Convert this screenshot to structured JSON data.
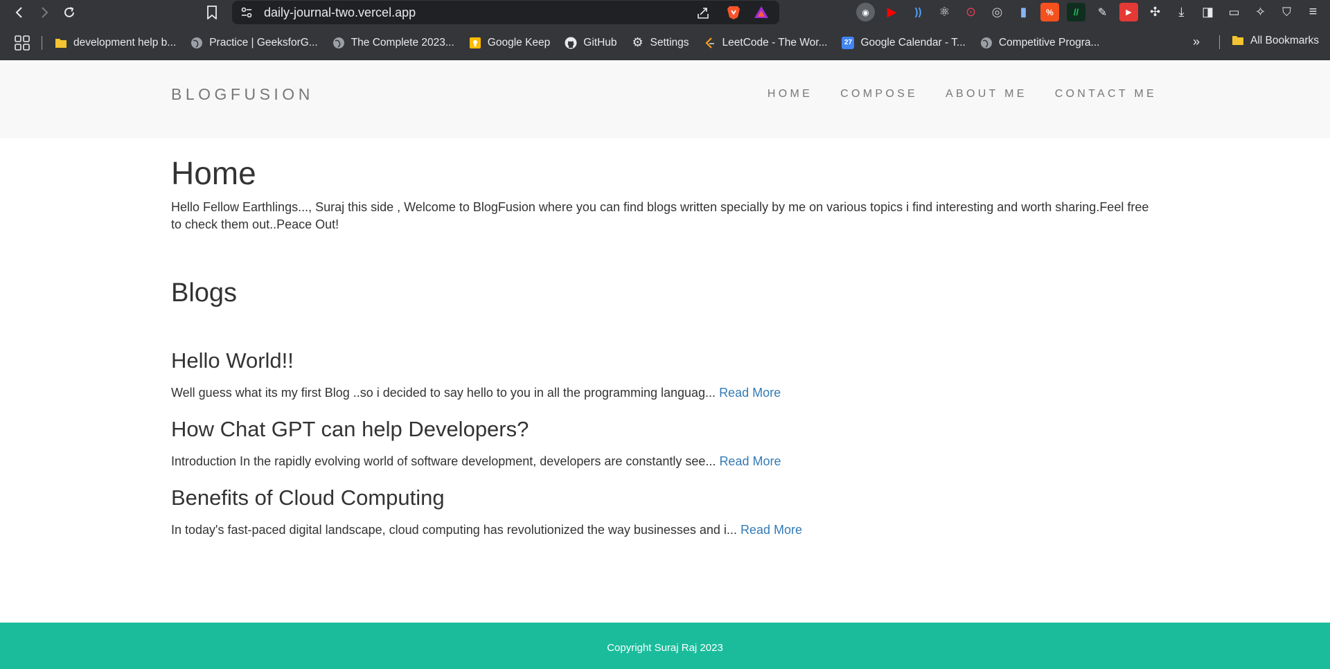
{
  "browser": {
    "url": "daily-journal-two.vercel.app",
    "bookmarks": [
      {
        "label": "development help b...",
        "icon": "folder-icon"
      },
      {
        "label": "Practice | GeeksforG...",
        "icon": "globe-icon"
      },
      {
        "label": "The Complete 2023...",
        "icon": "globe-icon"
      },
      {
        "label": "Google Keep",
        "icon": "keep-icon"
      },
      {
        "label": "GitHub",
        "icon": "github-icon"
      },
      {
        "label": "Settings",
        "icon": "gear-icon"
      },
      {
        "label": "LeetCode - The Wor...",
        "icon": "leetcode-icon"
      },
      {
        "label": "Google Calendar - T...",
        "icon": "calendar-icon"
      },
      {
        "label": "Competitive Progra...",
        "icon": "globe-icon"
      }
    ],
    "all_bookmarks_label": "All Bookmarks",
    "calendar_day": "27"
  },
  "site": {
    "brand": "BLOGFUSION",
    "nav": {
      "home": "HOME",
      "compose": "COMPOSE",
      "about": "ABOUT ME",
      "contact": "CONTACT ME"
    },
    "heading": "Home",
    "intro": "Hello Fellow Earthlings..., Suraj this side , Welcome to BlogFusion where you can find blogs written specially by me on various topics i find interesting and worth sharing.Feel free to check them out..Peace Out!",
    "blogs_heading": "Blogs",
    "posts": [
      {
        "title": "Hello World!!",
        "excerpt": "Well guess what its my first Blog ..so i decided to say hello to you in all the programming languag... ",
        "link": "Read More"
      },
      {
        "title": "How Chat GPT can help Developers?",
        "excerpt": "Introduction In the rapidly evolving world of software development, developers are constantly see... ",
        "link": "Read More"
      },
      {
        "title": "Benefits of Cloud Computing",
        "excerpt": "In today's fast-paced digital landscape, cloud computing has revolutionized the way businesses and i... ",
        "link": "Read More"
      }
    ],
    "footer": "Copyright Suraj Raj 2023"
  },
  "colors": {
    "chrome": "#35363a",
    "omnibox": "#202124",
    "header_bg": "#f8f8f8",
    "footer_bg": "#1abc9c",
    "link": "#337ab7"
  }
}
